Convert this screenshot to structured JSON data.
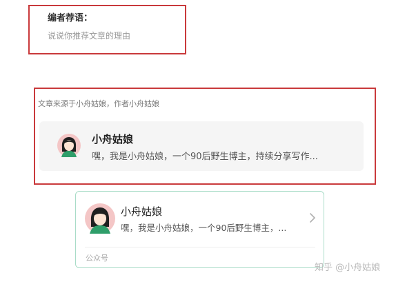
{
  "editor": {
    "title": "编者荐语：",
    "placeholder": "说说你推荐文章的理由"
  },
  "source": {
    "label": "文章来源于小舟姑娘，作者小舟姑娘",
    "author_name": "小舟姑娘",
    "author_desc": "嘿，我是小舟姑娘，一个90后野生博主，持续分享写作..."
  },
  "account": {
    "name": "小舟姑娘",
    "desc": "嘿，我是小舟姑娘，一个90后野生博主，...",
    "type": "公众号",
    "chevron_icon": "chevron-right-icon"
  },
  "watermark": {
    "platform": "知乎",
    "handle": "@小舟姑娘"
  },
  "colors": {
    "highlight_border": "#c9393b",
    "card_border": "#a8dcc7",
    "card_bg": "#f5f5f5"
  }
}
